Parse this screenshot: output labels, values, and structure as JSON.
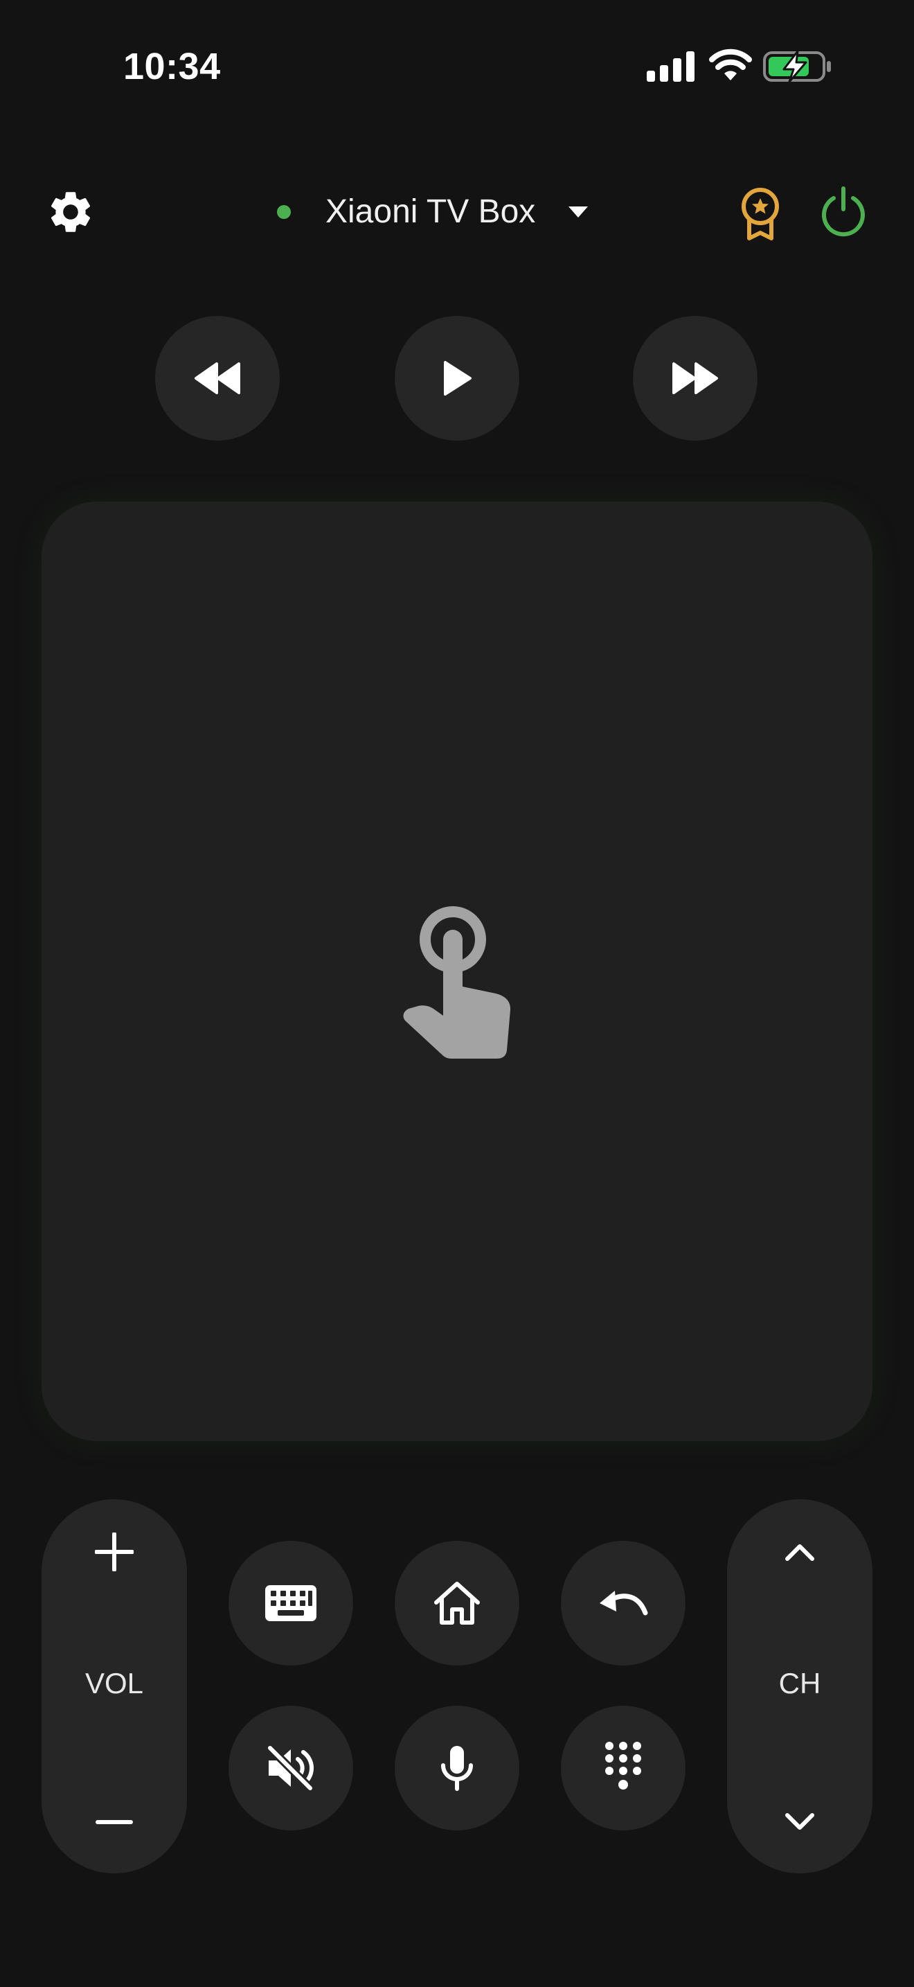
{
  "status_bar": {
    "time": "10:34"
  },
  "header": {
    "device_name": "Xiaoni TV Box",
    "connection_status_color": "#4caf50",
    "award_color": "#e3a63a",
    "power_color": "#4caf50"
  },
  "media_controls": {
    "rewind_icon": "rewind-icon",
    "play_icon": "play-icon",
    "fast_forward_icon": "fast-forward-icon"
  },
  "touchpad": {
    "icon": "touch-gesture-icon"
  },
  "volume": {
    "label": "VOL",
    "up_icon": "plus-icon",
    "down_icon": "minus-icon"
  },
  "channel": {
    "label": "CH",
    "up_icon": "chevron-up-icon",
    "down_icon": "chevron-down-icon"
  },
  "grid_buttons": [
    "keyboard-icon",
    "home-icon",
    "back-icon",
    "mute-icon",
    "microphone-icon",
    "numpad-icon"
  ],
  "colors": {
    "background": "#131313",
    "button": "#262626",
    "touchpad": "#202020",
    "battery_fill": "#34c759"
  }
}
